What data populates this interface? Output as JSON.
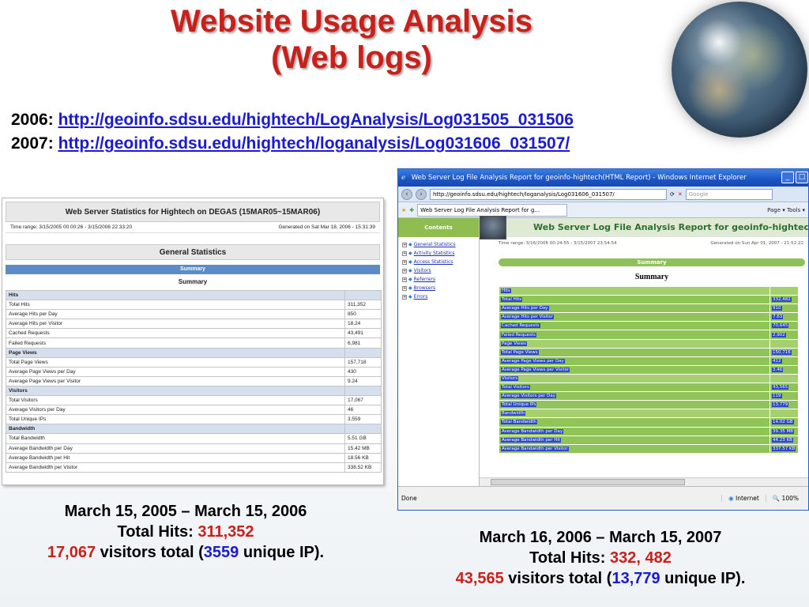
{
  "slide": {
    "title_line1": "Website Usage Analysis",
    "title_line2": "(Web logs)"
  },
  "links": [
    {
      "year": "2006:",
      "url": "http://geoinfo.sdsu.edu/hightech/LogAnalysis/Log031505_031506"
    },
    {
      "year": "2007:",
      "url": "http://geoinfo.sdsu.edu/hightech/loganalysis/Log031606_031507/"
    }
  ],
  "left_report": {
    "header": "Web Server Statistics for Hightech on DEGAS (15MAR05~15MAR06)",
    "time_range": "Time range: 3/15/2005 00:00:26 - 3/15/2006 22:33:20",
    "generated": "Generated on Sat Mar 18, 2006 - 15:31:39",
    "section_title": "General Statistics",
    "summary_bar": "Summary",
    "summary_label": "Summary",
    "rows": [
      {
        "label": "Hits",
        "value": "",
        "section": true
      },
      {
        "label": "Total Hits",
        "value": "311,352"
      },
      {
        "label": "Average Hits per Day",
        "value": "850"
      },
      {
        "label": "Average Hits per Visitor",
        "value": "18.24"
      },
      {
        "label": "Cached Requests",
        "value": "43,491"
      },
      {
        "label": "Failed Requests",
        "value": "6,981"
      },
      {
        "label": "Page Views",
        "value": "",
        "section": true
      },
      {
        "label": "Total Page Views",
        "value": "157,718"
      },
      {
        "label": "Average Page Views per Day",
        "value": "430"
      },
      {
        "label": "Average Page Views per Visitor",
        "value": "9.24"
      },
      {
        "label": "Visitors",
        "value": "",
        "section": true
      },
      {
        "label": "Total Visitors",
        "value": "17,067"
      },
      {
        "label": "Average Visitors per Day",
        "value": "46"
      },
      {
        "label": "Total Unique IPs",
        "value": "3,559"
      },
      {
        "label": "Bandwidth",
        "value": "",
        "section": true
      },
      {
        "label": "Total Bandwidth",
        "value": "5.51 GB"
      },
      {
        "label": "Average Bandwidth per Day",
        "value": "15.42 MB"
      },
      {
        "label": "Average Bandwidth per Hit",
        "value": "18.56 KB"
      },
      {
        "label": "Average Bandwidth per Visitor",
        "value": "338.52 KB"
      }
    ]
  },
  "ie": {
    "window_title": "Web Server Log File Analysis Report for geoinfo-hightech(HTML Report) - Windows Internet Explorer",
    "url": "http://geoinfo.sdsu.edu/hightech/loganalysis/Log031606_031507/",
    "search_placeholder": "Google",
    "tab_label": "Web Server Log File Analysis Report for g...",
    "tools_text": "Page ▾  Tools ▾",
    "contents_label": "Contents",
    "tree": [
      "General Statistics",
      "Activity Statistics",
      "Access Statistics",
      "Visitors",
      "Referrers",
      "Browsers",
      "Errors"
    ],
    "report_title": "Web Server Log File Analysis Report for geoinfo-hightech(H",
    "time_range": "Time range: 3/16/2006 00:24:55 - 3/15/2007 23:54:54",
    "generated": "Generated on Sun Apr 01, 2007 - 21:52:22",
    "summary_bar": "Summary",
    "summary_label": "Summary",
    "rows": [
      {
        "label": "Hits",
        "value": "",
        "section": true
      },
      {
        "label": "Total Hits",
        "value": "332,482"
      },
      {
        "label": "Average Hits per Day",
        "value": "910"
      },
      {
        "label": "Average Hits per Visitor",
        "value": "7.63"
      },
      {
        "label": "Cached Requests",
        "value": "70,645"
      },
      {
        "label": "Failed Requests",
        "value": "2,902"
      },
      {
        "label": "Page Views",
        "value": "",
        "section": true
      },
      {
        "label": "Total Page Views",
        "value": "150,716"
      },
      {
        "label": "Average Page Views per Day",
        "value": "412"
      },
      {
        "label": "Average Page Views per Visitor",
        "value": "3.46"
      },
      {
        "label": "Visitors",
        "value": "",
        "section": true
      },
      {
        "label": "Total Visitors",
        "value": "43,565"
      },
      {
        "label": "Average Visitors per Day",
        "value": "119"
      },
      {
        "label": "Total Unique IPs",
        "value": "13,779"
      },
      {
        "label": "Bandwidth",
        "value": "",
        "section": true
      },
      {
        "label": "Total Bandwidth",
        "value": "14.02 GB"
      },
      {
        "label": "Average Bandwidth per Day",
        "value": "39.35 MB"
      },
      {
        "label": "Average Bandwidth per Hit",
        "value": "44.23 KB"
      },
      {
        "label": "Average Bandwidth per Visitor",
        "value": "337.57 KB"
      }
    ],
    "status_left": "Done",
    "status_zone": "Internet",
    "status_zoom": "100%"
  },
  "caption_left": {
    "dates": "March 15, 2005 – March 15, 2006",
    "hits_label": "Total Hits: ",
    "hits_value": "311,352",
    "visitors_value": "17,067",
    "visitors_text": " visitors total (",
    "unique_value": "3559",
    "unique_text": " unique IP)."
  },
  "caption_right": {
    "dates": "March 16, 2006 – March 15, 2007",
    "hits_label": "Total Hits: ",
    "hits_value": "332, 482",
    "visitors_value": "43,565",
    "visitors_text": "  visitors total (",
    "unique_value": "13,779",
    "unique_text": "  unique IP)."
  }
}
